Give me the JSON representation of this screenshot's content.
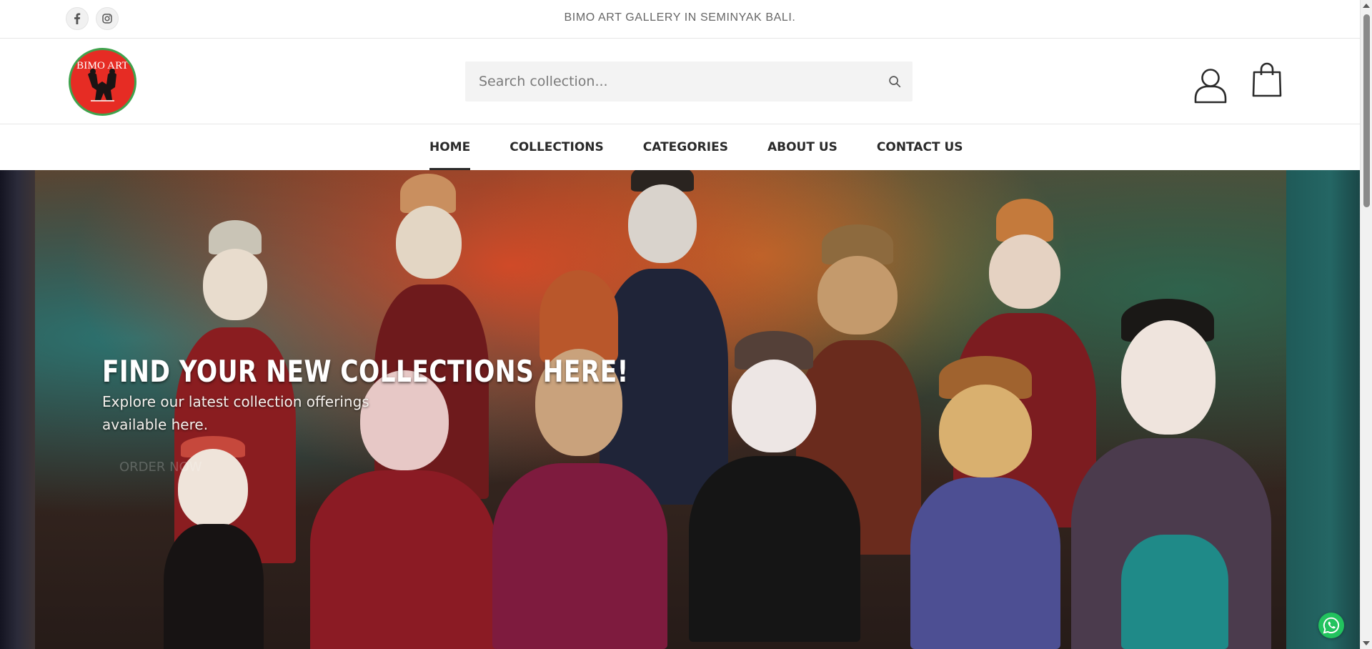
{
  "topbar": {
    "social": [
      {
        "name": "facebook",
        "icon": "facebook-icon"
      },
      {
        "name": "instagram",
        "icon": "instagram-icon"
      }
    ],
    "announcement": "BIMO ART GALLERY IN SEMINYAK BALI."
  },
  "header": {
    "logo_text": "BIMO ART",
    "search": {
      "placeholder": "Search collection...",
      "value": ""
    },
    "icons": {
      "search": "search-icon",
      "account": "user-icon",
      "cart": "shopping-bag-icon"
    }
  },
  "nav": {
    "items": [
      {
        "label": "HOME",
        "active": true
      },
      {
        "label": "COLLECTIONS",
        "active": false
      },
      {
        "label": "CATEGORIES",
        "active": false
      },
      {
        "label": "ABOUT US",
        "active": false
      },
      {
        "label": "CONTACT US",
        "active": false
      }
    ]
  },
  "hero": {
    "title": "FIND YOUR NEW COLLECTIONS HERE!",
    "subtitle": "Explore our latest collection offerings available here.",
    "cta": "ORDER NOW"
  },
  "floating": {
    "whatsapp": "whatsapp-icon"
  },
  "colors": {
    "logo_bg": "#e62c24",
    "logo_ring": "#3fa34d",
    "whatsapp": "#22c35e",
    "text_dark": "#2a2a2a"
  }
}
